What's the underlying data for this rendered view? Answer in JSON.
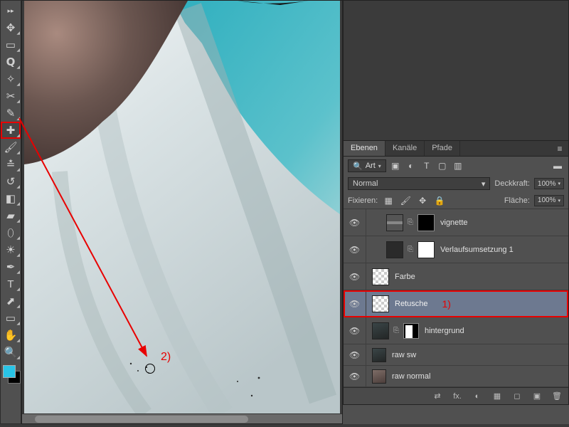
{
  "tools": [
    {
      "name": "move-tool",
      "glyph": "✥"
    },
    {
      "name": "marquee-tool",
      "glyph": "▭"
    },
    {
      "name": "lasso-tool",
      "glyph": "𝗤"
    },
    {
      "name": "magic-wand-tool",
      "glyph": "✧"
    },
    {
      "name": "crop-tool",
      "glyph": "✂"
    },
    {
      "name": "eyedropper-tool",
      "glyph": "✎"
    },
    {
      "name": "healing-brush-tool",
      "glyph": "✚",
      "highlight": true
    },
    {
      "name": "brush-tool",
      "glyph": "🖌"
    },
    {
      "name": "clone-stamp-tool",
      "glyph": "≛"
    },
    {
      "name": "history-brush-tool",
      "glyph": "↺"
    },
    {
      "name": "eraser-tool",
      "glyph": "◧"
    },
    {
      "name": "gradient-tool",
      "glyph": "▰"
    },
    {
      "name": "blur-tool",
      "glyph": "⬯"
    },
    {
      "name": "dodge-tool",
      "glyph": "☀"
    },
    {
      "name": "pen-tool",
      "glyph": "✒"
    },
    {
      "name": "type-tool",
      "glyph": "T"
    },
    {
      "name": "path-selection-tool",
      "glyph": "⬈"
    },
    {
      "name": "shape-tool",
      "glyph": "▭"
    },
    {
      "name": "hand-tool",
      "glyph": "✋"
    },
    {
      "name": "zoom-tool",
      "glyph": "🔍"
    }
  ],
  "panel_tabs": {
    "layers": "Ebenen",
    "channels": "Kanäle",
    "paths": "Pfade"
  },
  "filter": {
    "label": "Art",
    "search_icon": "🔍"
  },
  "blend": {
    "mode": "Normal",
    "opacity_label": "Deckkraft:",
    "opacity": "100%"
  },
  "lock": {
    "label": "Fixieren:",
    "fill_label": "Fläche:",
    "fill": "100%"
  },
  "layers": [
    {
      "name": "vignette",
      "indent": true,
      "fx": true,
      "mask": "black"
    },
    {
      "name": "Verlaufsumsetzung 1",
      "indent": true,
      "fx": true,
      "mask": "white",
      "thumb": "dark"
    },
    {
      "name": "Farbe",
      "checker": true
    },
    {
      "name": "Retusche",
      "checker": true,
      "selected": true,
      "annot": "1)"
    },
    {
      "name": "hintergrund",
      "img": "img1",
      "mask": "shape"
    },
    {
      "name": "raw sw",
      "img": "img1",
      "short": true
    },
    {
      "name": "raw normal",
      "img": "img2",
      "short": true
    }
  ],
  "bottom_icons": [
    "⇄",
    "fx.",
    "◐",
    "▦",
    "◻",
    "▣",
    "🗑"
  ],
  "annotation2": "2)",
  "colors": {
    "foreground": "#29c4e6",
    "background": "#000000",
    "accent_red": "#e80000"
  }
}
